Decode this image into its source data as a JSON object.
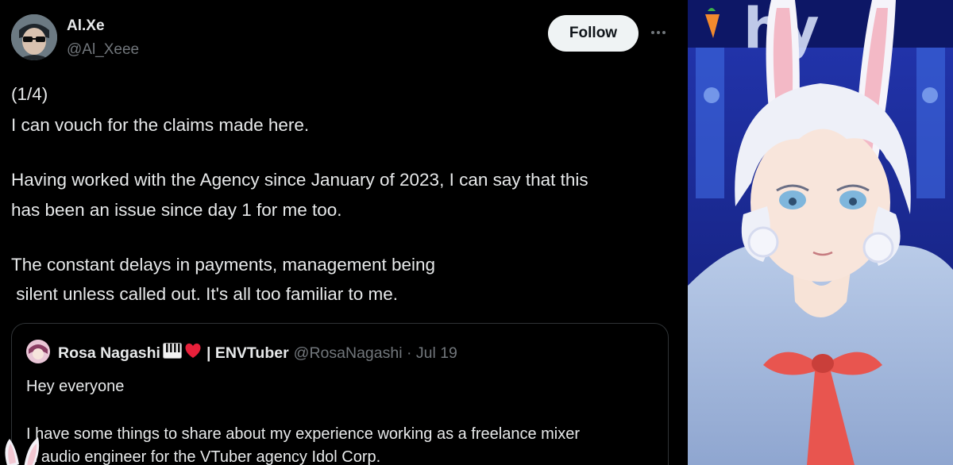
{
  "tweet": {
    "author_name": "Al.Xe",
    "author_handle": "@Al_Xeee",
    "follow_label": "Follow",
    "more_label": "···",
    "lines": [
      "(1/4)",
      "I can vouch for the claims made here.",
      "Having worked with the Agency since January of 2023, I can say that this",
      "has been an issue since day 1 for me too.",
      "The constant delays in payments, management being",
      " silent unless called out. It's all too familiar to me."
    ]
  },
  "quote": {
    "name": "Rosa Nagashi",
    "org": "| ENVTuber",
    "handle": "@RosaNagashi · Jul 19",
    "lines": [
      "Hey everyone",
      "I have some things to share about my experience working as a freelance mixer",
      "& audio engineer for the VTuber agency Idol Corp."
    ]
  },
  "colors": {
    "background": "#000000",
    "text": "#e7e9ea",
    "muted": "#71767b",
    "follow_bg": "#eff3f4",
    "heart": "#f91880"
  },
  "icons": {
    "more": "more-icon",
    "piano": "piano-icon",
    "heart": "heart-icon"
  }
}
